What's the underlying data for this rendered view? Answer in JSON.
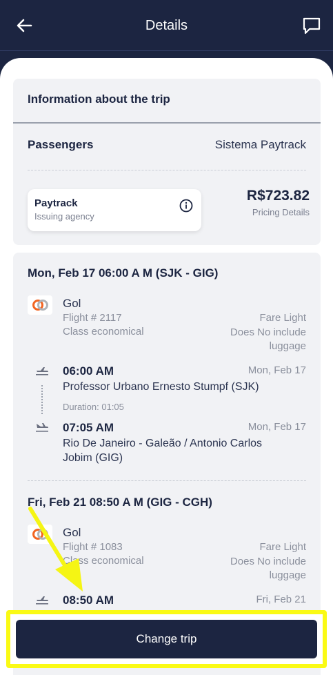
{
  "header": {
    "title": "Details",
    "back_icon": "arrow-left-icon",
    "chat_icon": "chat-bubble-icon"
  },
  "trip_info": {
    "heading": "Information about the trip",
    "passengers_label": "Passengers",
    "passengers_value": "Sistema Paytrack",
    "agency": {
      "name": "Paytrack",
      "subtitle": "Issuing agency"
    },
    "price": "R$723.82",
    "pricing_link": "Pricing Details"
  },
  "segments": [
    {
      "title": "Mon, Feb 17 06:00 A M (SJK - GIG)",
      "airline": "Gol",
      "flight": "Flight # 2117",
      "class": "Class economical",
      "fare": "Fare Light",
      "luggage": "Does No include luggage",
      "departure_time": "06:00 AM",
      "departure_date": "Mon, Feb 17",
      "departure_place": "Professor Urbano Ernesto Stumpf (SJK)",
      "duration": "Duration: 01:05",
      "arrival_time": "07:05 AM",
      "arrival_date": "Mon, Feb 17",
      "arrival_place": "Rio De Janeiro - Galeão / Antonio Carlos Jobim (GIG)"
    },
    {
      "title": "Fri, Feb 21 08:50 A M (GIG - CGH)",
      "airline": "Gol",
      "flight": "Flight # 1083",
      "class": "Class economical",
      "fare": "Fare Light",
      "luggage": "Does No include luggage",
      "departure_time": "08:50 AM",
      "departure_date": "Fri, Feb 21"
    }
  ],
  "footer": {
    "change_trip_label": "Change trip"
  },
  "colors": {
    "navy": "#1c2541",
    "card_bg": "#f1f2f5",
    "highlight": "#fafa14",
    "gol_orange": "#f26522"
  }
}
